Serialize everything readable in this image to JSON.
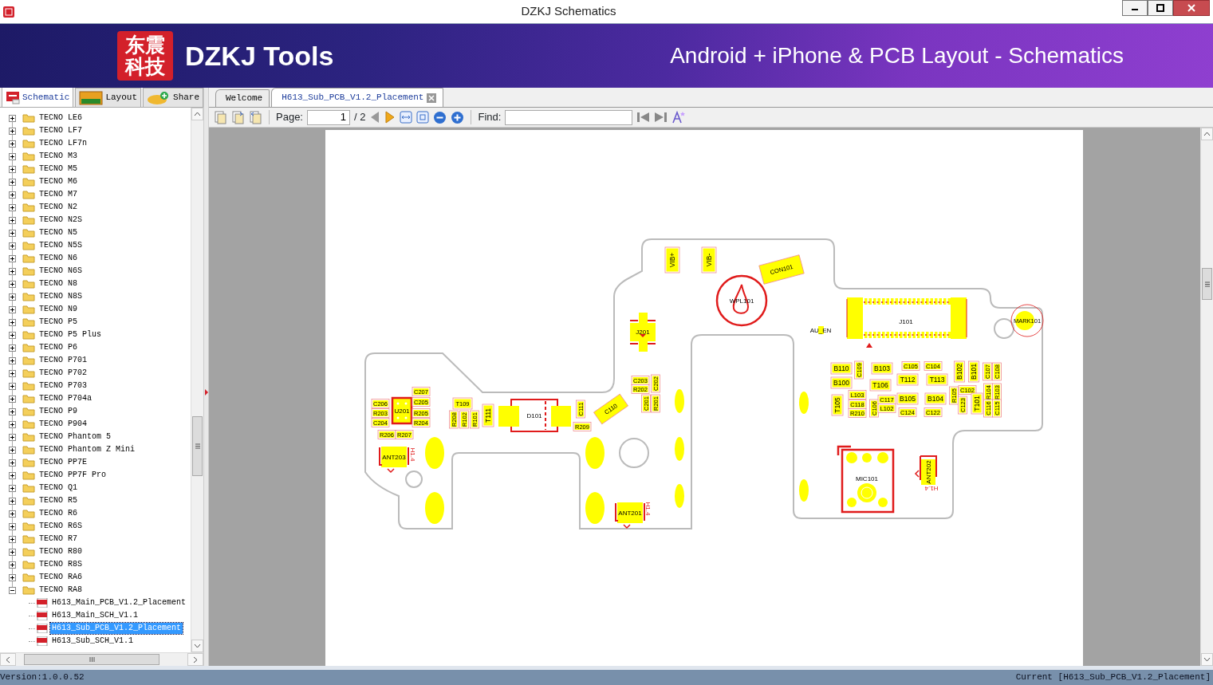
{
  "window": {
    "title": "DZKJ Schematics"
  },
  "banner": {
    "logo_text": "东震科技",
    "brand": "DZKJ Tools",
    "tagline": "Android + iPhone & PCB Layout - Schematics"
  },
  "side_tabs": [
    {
      "label": "Schematic",
      "kind": "pdf",
      "selected": true
    },
    {
      "label": "Layout",
      "kind": "pads",
      "selected": false
    },
    {
      "label": "Share",
      "kind": "share",
      "selected": false
    }
  ],
  "tree": {
    "items": [
      {
        "label": "TECNO LE6",
        "expanded": false
      },
      {
        "label": "TECNO LF7",
        "expanded": false
      },
      {
        "label": "TECNO LF7n",
        "expanded": false
      },
      {
        "label": "TECNO M3",
        "expanded": false
      },
      {
        "label": "TECNO M5",
        "expanded": false
      },
      {
        "label": "TECNO M6",
        "expanded": false
      },
      {
        "label": "TECNO M7",
        "expanded": false
      },
      {
        "label": "TECNO N2",
        "expanded": false
      },
      {
        "label": "TECNO N2S",
        "expanded": false
      },
      {
        "label": "TECNO N5",
        "expanded": false
      },
      {
        "label": "TECNO N5S",
        "expanded": false
      },
      {
        "label": "TECNO N6",
        "expanded": false
      },
      {
        "label": "TECNO N6S",
        "expanded": false
      },
      {
        "label": "TECNO N8",
        "expanded": false
      },
      {
        "label": "TECNO N8S",
        "expanded": false
      },
      {
        "label": "TECNO N9",
        "expanded": false
      },
      {
        "label": "TECNO P5",
        "expanded": false
      },
      {
        "label": "TECNO P5 Plus",
        "expanded": false
      },
      {
        "label": "TECNO P6",
        "expanded": false
      },
      {
        "label": "TECNO P701",
        "expanded": false
      },
      {
        "label": "TECNO P702",
        "expanded": false
      },
      {
        "label": "TECNO P703",
        "expanded": false
      },
      {
        "label": "TECNO P704a",
        "expanded": false
      },
      {
        "label": "TECNO P9",
        "expanded": false
      },
      {
        "label": "TECNO P904",
        "expanded": false
      },
      {
        "label": "TECNO Phantom 5",
        "expanded": false
      },
      {
        "label": "TECNO Phantom Z Mini",
        "expanded": false
      },
      {
        "label": "TECNO PP7E",
        "expanded": false
      },
      {
        "label": "TECNO PP7F Pro",
        "expanded": false
      },
      {
        "label": "TECNO Q1",
        "expanded": false
      },
      {
        "label": "TECNO R5",
        "expanded": false
      },
      {
        "label": "TECNO R6",
        "expanded": false
      },
      {
        "label": "TECNO R6S",
        "expanded": false
      },
      {
        "label": "TECNO R7",
        "expanded": false
      },
      {
        "label": "TECNO R80",
        "expanded": false
      },
      {
        "label": "TECNO R8S",
        "expanded": false
      },
      {
        "label": "TECNO RA6",
        "expanded": false
      },
      {
        "label": "TECNO RA8",
        "expanded": true,
        "children": [
          {
            "label": "H613_Main_PCB_V1.2_Placement",
            "selected": false
          },
          {
            "label": "H613_Main_SCH_V1.1",
            "selected": false
          },
          {
            "label": "H613_Sub_PCB_V1.2_Placement",
            "selected": true
          },
          {
            "label": "H613_Sub_SCH_V1.1",
            "selected": false
          }
        ]
      }
    ]
  },
  "doc_tabs": [
    {
      "label": "Welcome",
      "selected": false
    },
    {
      "label": "H613_Sub_PCB_V1.2_Placement",
      "selected": true
    }
  ],
  "toolbar": {
    "page_label": "Page:",
    "page_value": "1",
    "page_total": "/ 2",
    "find_label": "Find:"
  },
  "pcb": {
    "components": [
      "VIB+",
      "VIB-",
      "CON101",
      "WPL101",
      "J201",
      "AU_EN",
      "J101",
      "MARK101",
      "C206",
      "R203",
      "C204",
      "U201",
      "C207",
      "C205",
      "R205",
      "R204",
      "R206",
      "R207",
      "T109",
      "R208",
      "R102",
      "R101",
      "T111",
      "D101",
      "C111",
      "C110",
      "R209",
      "C203",
      "R202",
      "C202",
      "C201",
      "R201",
      "ANT203",
      "ANT201",
      "B110",
      "C109",
      "B100",
      "B103",
      "T106",
      "C105",
      "T112",
      "C104",
      "T113",
      "B102",
      "B101",
      "C107",
      "C108",
      "T105",
      "L103",
      "C118",
      "R210",
      "C106",
      "C117",
      "L102",
      "B105",
      "C124",
      "B104",
      "C122",
      "R105",
      "C102",
      "C123",
      "T101",
      "R104",
      "R103",
      "C116",
      "C115",
      "MIC101",
      "ANT202"
    ],
    "notes": [
      "H1.4",
      "H1.4",
      "H1.4"
    ]
  },
  "status_bar": {
    "version": "Version:1.0.0.52",
    "current": "Current [H613_Sub_PCB_V1.2_Placement]"
  }
}
